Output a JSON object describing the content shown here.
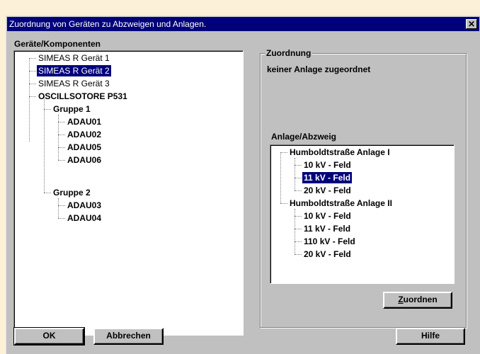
{
  "dialog": {
    "title": "Zuordnung von Geräten zu Abzweigen und Anlagen.",
    "close_glyph": "✕"
  },
  "left_panel": {
    "label": "Geräte/Komponenten",
    "tree": [
      {
        "label": "SIMEAS R  Gerät 1",
        "selected": false
      },
      {
        "label": "SIMEAS R  Gerät 2",
        "selected": true
      },
      {
        "label": "SIMEAS R  Gerät 3",
        "selected": false
      },
      {
        "label": "OSCILLSOTORE P531",
        "selected": false
      },
      {
        "label": "Gruppe 1",
        "selected": false
      },
      {
        "label": "ADAU01",
        "selected": false
      },
      {
        "label": "ADAU02",
        "selected": false
      },
      {
        "label": "ADAU05",
        "selected": false
      },
      {
        "label": "ADAU06",
        "selected": false
      },
      {
        "label": "Gruppe 2",
        "selected": false
      },
      {
        "label": "ADAU03",
        "selected": false
      },
      {
        "label": "ADAU04",
        "selected": false
      }
    ]
  },
  "right_panel": {
    "group_title": "Zuordnung",
    "status": "keiner Anlage zugeordnet",
    "list_label": "Anlage/Abzweig",
    "tree": [
      {
        "label": "Humboldtstraße  Anlage I",
        "selected": false
      },
      {
        "label": "10 kV - Feld",
        "selected": false
      },
      {
        "label": "11 kV - Feld",
        "selected": true
      },
      {
        "label": "20 kV - Feld",
        "selected": false
      },
      {
        "label": "Humboldtstraße  Anlage II",
        "selected": false
      },
      {
        "label": "10 kV - Feld",
        "selected": false
      },
      {
        "label": "11 kV - Feld",
        "selected": false
      },
      {
        "label": "110 kV - Feld",
        "selected": false
      },
      {
        "label": "20 kV - Feld",
        "selected": false
      }
    ],
    "assign_button": {
      "mnemonic": "Z",
      "rest": "uordnen"
    }
  },
  "buttons": {
    "ok": "OK",
    "cancel": "Abbrechen",
    "help": "Hilfe"
  },
  "colors": {
    "selection": "#00007b",
    "title_bar": "#00007b",
    "face": "#c0c0c0"
  }
}
